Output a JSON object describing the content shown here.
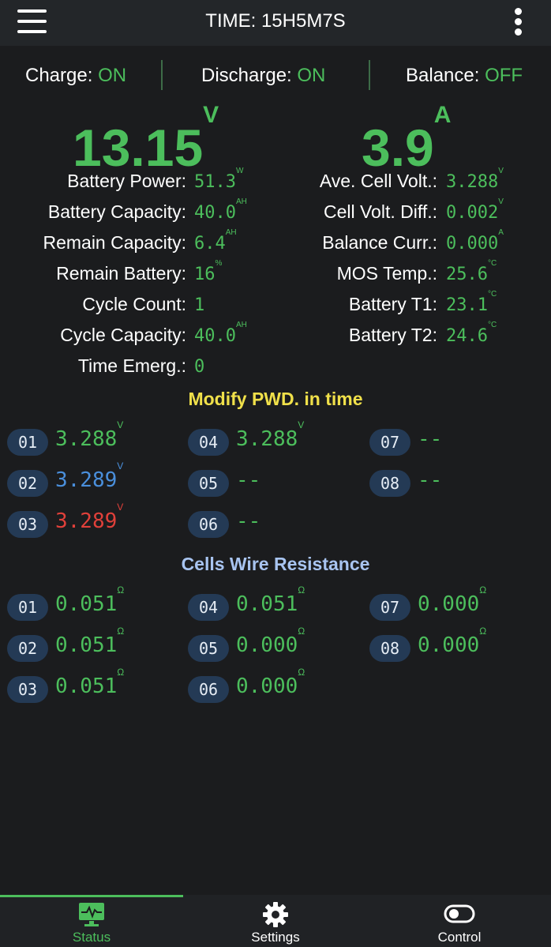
{
  "header": {
    "title": "TIME: 15H5M7S",
    "menu_icon": "hamburger-icon",
    "more_icon": "more-vertical-icon"
  },
  "status": {
    "charge": {
      "label": "Charge:",
      "value": "ON"
    },
    "discharge": {
      "label": "Discharge:",
      "value": "ON"
    },
    "balance": {
      "label": "Balance:",
      "value": "OFF"
    }
  },
  "main": {
    "voltage": {
      "value": "13.15",
      "unit": "V"
    },
    "current": {
      "value": "3.9",
      "unit": "A"
    }
  },
  "left_stats": [
    {
      "label": "Battery Power:",
      "value": "51.3",
      "unit": "W"
    },
    {
      "label": "Battery Capacity:",
      "value": "40.0",
      "unit": "AH"
    },
    {
      "label": "Remain Capacity:",
      "value": "6.4",
      "unit": "AH"
    },
    {
      "label": "Remain Battery:",
      "value": "16",
      "unit": "%"
    },
    {
      "label": "Cycle Count:",
      "value": "1",
      "unit": ""
    },
    {
      "label": "Cycle Capacity:",
      "value": "40.0",
      "unit": "AH"
    },
    {
      "label": "Time Emerg.:",
      "value": "0",
      "unit": ""
    }
  ],
  "right_stats": [
    {
      "label": "Ave. Cell Volt.:",
      "value": "3.288",
      "unit": "V"
    },
    {
      "label": "Cell Volt. Diff.:",
      "value": "0.002",
      "unit": "V"
    },
    {
      "label": "Balance Curr.:",
      "value": "0.000",
      "unit": "A"
    },
    {
      "label": "MOS Temp.:",
      "value": "25.6",
      "unit": "°C"
    },
    {
      "label": "Battery T1:",
      "value": "23.1",
      "unit": "°C"
    },
    {
      "label": "Battery T2:",
      "value": "24.6",
      "unit": "°C"
    }
  ],
  "pwd_section": {
    "title": "Modify PWD. in time"
  },
  "cell_voltages": [
    {
      "id": "01",
      "value": "3.288",
      "unit": "V",
      "color": "#4cbe5c"
    },
    {
      "id": "02",
      "value": "3.289",
      "unit": "V",
      "color": "#4a8fdc"
    },
    {
      "id": "03",
      "value": "3.289",
      "unit": "V",
      "color": "#e0403a"
    },
    {
      "id": "04",
      "value": "3.288",
      "unit": "V",
      "color": "#4cbe5c"
    },
    {
      "id": "05",
      "value": "--",
      "unit": "",
      "color": "#4cbe5c"
    },
    {
      "id": "06",
      "value": "--",
      "unit": "",
      "color": "#4cbe5c"
    },
    {
      "id": "07",
      "value": "--",
      "unit": "",
      "color": "#4cbe5c"
    },
    {
      "id": "08",
      "value": "--",
      "unit": "",
      "color": "#4cbe5c"
    }
  ],
  "resistance_section": {
    "title": "Cells Wire Resistance"
  },
  "cell_resistances": [
    {
      "id": "01",
      "value": "0.051",
      "unit": "Ω"
    },
    {
      "id": "02",
      "value": "0.051",
      "unit": "Ω"
    },
    {
      "id": "03",
      "value": "0.051",
      "unit": "Ω"
    },
    {
      "id": "04",
      "value": "0.051",
      "unit": "Ω"
    },
    {
      "id": "05",
      "value": "0.000",
      "unit": "Ω"
    },
    {
      "id": "06",
      "value": "0.000",
      "unit": "Ω"
    },
    {
      "id": "07",
      "value": "0.000",
      "unit": "Ω"
    },
    {
      "id": "08",
      "value": "0.000",
      "unit": "Ω"
    }
  ],
  "tabs": [
    {
      "label": "Status",
      "icon": "monitor-pulse-icon",
      "active": true,
      "color": "#4cbe5c"
    },
    {
      "label": "Settings",
      "icon": "gear-icon",
      "active": false,
      "color": "#ffffff"
    },
    {
      "label": "Control",
      "icon": "toggle-icon",
      "active": false,
      "color": "#ffffff"
    }
  ],
  "colors": {
    "accent": "#4cbe5c",
    "background": "#1b1c1e",
    "pwd_title": "#f0e04a",
    "resistance_title": "#a8c4f0"
  }
}
